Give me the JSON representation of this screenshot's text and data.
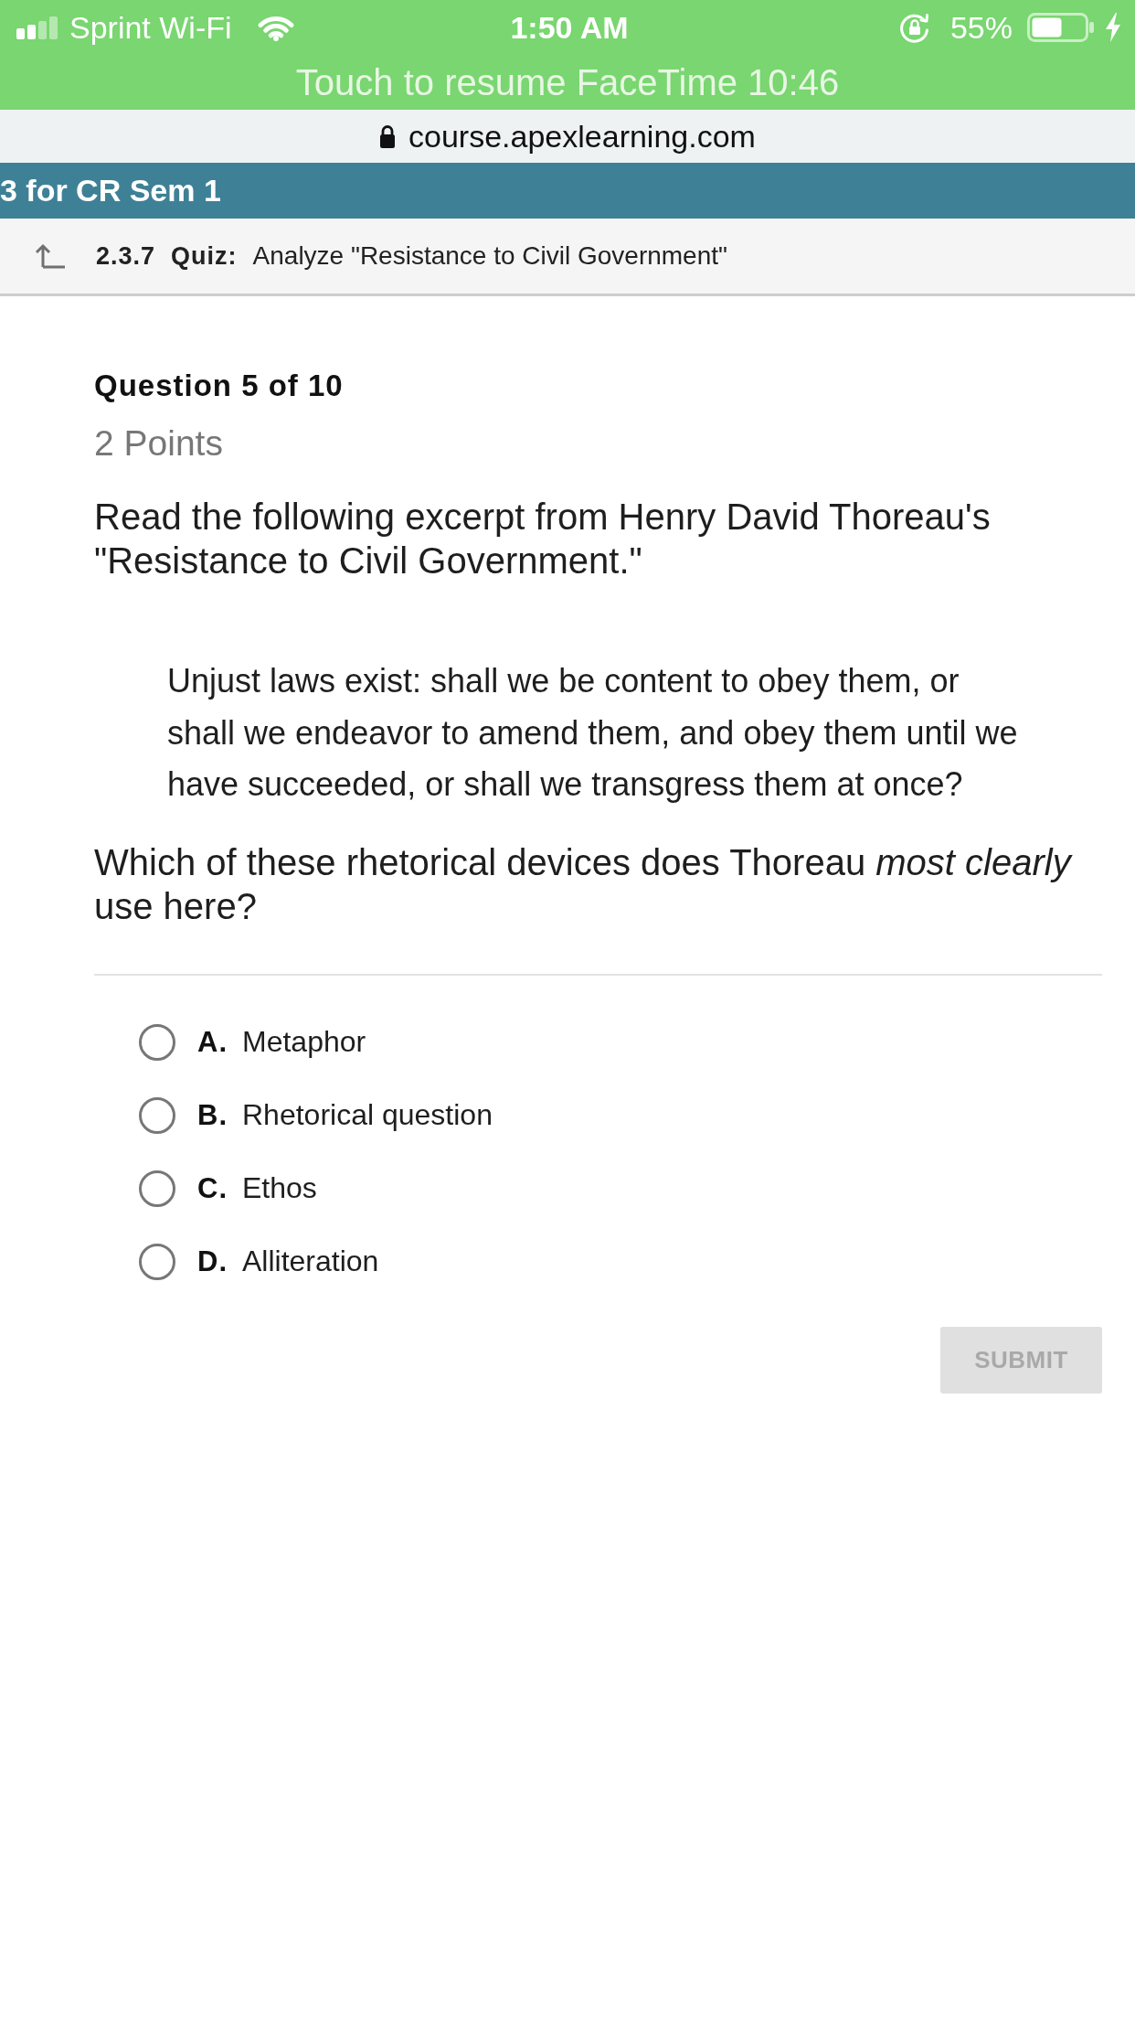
{
  "status_bar": {
    "carrier": "Sprint Wi-Fi",
    "time": "1:50 AM",
    "battery": "55%",
    "banner": "Touch to resume FaceTime 10:46"
  },
  "address_bar": {
    "url": "course.apexlearning.com"
  },
  "course_bar": {
    "title": "3 for CR Sem 1"
  },
  "quiz_header": {
    "number": "2.3.7",
    "type": "Quiz:",
    "title": "Analyze \"Resistance to Civil Government\""
  },
  "question": {
    "counter": "Question 5 of 10",
    "points": "2 Points",
    "prompt": "Read the following excerpt from Henry David Thoreau's \"Resistance to Civil Government.\"",
    "excerpt": "Unjust laws exist: shall we be content to obey them, or shall we endeavor to amend them, and obey them until we have succeeded, or shall we transgress them at once?",
    "ask": "Which of these rhetorical devices does Thoreau *most clearly* use here?"
  },
  "options": [
    {
      "letter": "A.",
      "text": "Metaphor",
      "selected": false
    },
    {
      "letter": "B.",
      "text": "Rhetorical question",
      "selected": false
    },
    {
      "letter": "C.",
      "text": "Ethos",
      "selected": false
    },
    {
      "letter": "D.",
      "text": "Alliteration",
      "selected": false
    }
  ],
  "submit": {
    "label": "SUBMIT",
    "disabled": true
  }
}
